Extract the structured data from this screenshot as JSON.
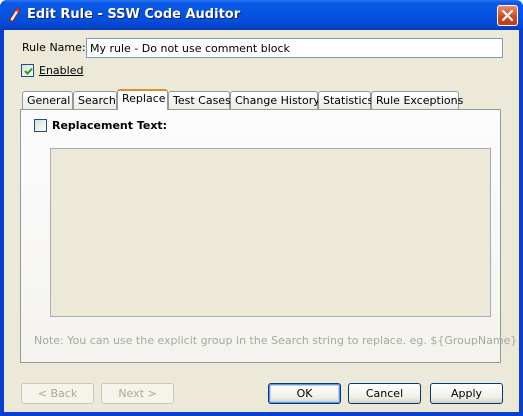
{
  "window": {
    "title": "Edit Rule - SSW Code Auditor",
    "close_glyph": "close-icon"
  },
  "rule_name": {
    "label": "Rule Name:",
    "value": "My rule - Do not use comment block"
  },
  "enabled": {
    "label": "Enabled",
    "checked": true
  },
  "tabs": [
    {
      "label": "General"
    },
    {
      "label": "Search"
    },
    {
      "label": "Replace",
      "active": true
    },
    {
      "label": "Test Cases"
    },
    {
      "label": "Change History"
    },
    {
      "label": "Statistics"
    },
    {
      "label": "Rule Exceptions"
    }
  ],
  "replace_tab": {
    "checkbox_label": "Replacement Text:",
    "checked": false,
    "text_value": "",
    "note": "Note: You can use the explicit group in the Search string to replace. eg. ${GroupName}"
  },
  "buttons": {
    "back": "< Back",
    "next": "Next >",
    "ok": "OK",
    "cancel": "Cancel",
    "apply": "Apply"
  },
  "colors": {
    "titlebar": "#0553e0",
    "client_bg": "#ece9d8",
    "active_tab_accent": "#e68b2c",
    "disabled_text": "#aca899"
  }
}
